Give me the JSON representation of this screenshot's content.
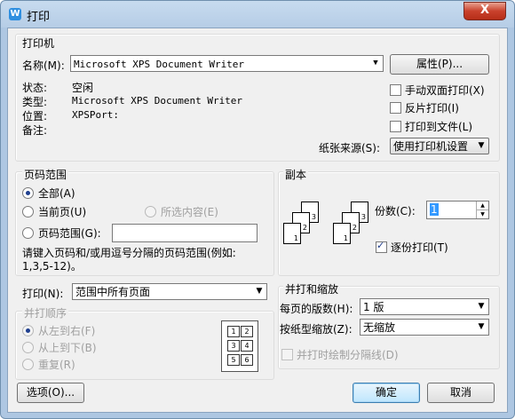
{
  "window": {
    "title": "打印",
    "close_symbol": "X"
  },
  "printer": {
    "group_label": "打印机",
    "name_label": "名称(M):",
    "name_value": "Microsoft XPS Document Writer",
    "properties_button": "属性(P)...",
    "status_label": "状态:",
    "status_value": "空闲",
    "type_label": "类型:",
    "type_value": "Microsoft XPS Document Writer",
    "location_label": "位置:",
    "location_value": "XPSPort:",
    "comment_label": "备注:",
    "duplex_label": "手动双面打印(X)",
    "reverse_label": "反片打印(I)",
    "print_to_file_label": "打印到文件(L)",
    "paper_source_label": "纸张来源(S):",
    "paper_source_value": "使用打印机设置"
  },
  "page_range": {
    "group_label": "页码范围",
    "all_label": "全部(A)",
    "current_label": "当前页(U)",
    "selection_label": "所选内容(E)",
    "range_label": "页码范围(G):",
    "range_value": "",
    "hint_line1": "请键入页码和/或用逗号分隔的页码范围(例如:",
    "hint_line2": "1,3,5-12)。"
  },
  "copies": {
    "group_label": "副本",
    "count_label": "份数(C):",
    "count_value": "1",
    "collate_label": "逐份打印(T)",
    "collate_checked": true,
    "icon_pages": [
      "1",
      "2",
      "3",
      "1",
      "2",
      "3"
    ]
  },
  "print_what": {
    "label": "打印(N):",
    "value": "范围中所有页面"
  },
  "collate_order": {
    "group_label": "并打顺序",
    "left_right_label": "从左到右(F)",
    "top_bottom_label": "从上到下(B)",
    "repeat_label": "重复(R)",
    "preview_numbers": [
      "1",
      "2",
      "3",
      "4",
      "5",
      "6"
    ]
  },
  "zoom": {
    "group_label": "并打和缩放",
    "pages_per_sheet_label": "每页的版数(H):",
    "pages_per_sheet_value": "1 版",
    "scale_label": "按纸型缩放(Z):",
    "scale_value": "无缩放",
    "draw_separator_label": "并打时绘制分隔线(D)"
  },
  "footer": {
    "options_button": "选项(O)...",
    "ok_button": "确定",
    "cancel_button": "取消"
  }
}
